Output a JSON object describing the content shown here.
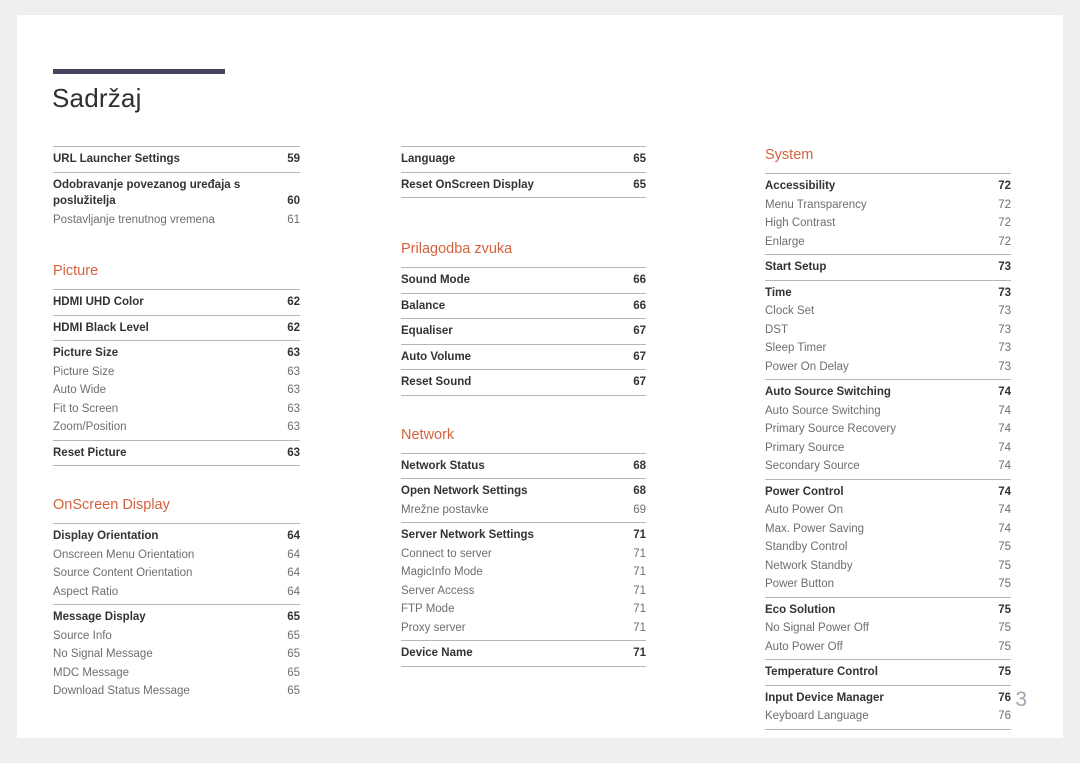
{
  "document": {
    "title": "Sadržaj",
    "folio": "3",
    "accent_color": "#d4623f",
    "rule_color": "#44445c",
    "page_background": "#ffffff",
    "canvas_background": "#efefef"
  },
  "columns": [
    {
      "name": "left",
      "blocks": [
        {
          "type": "group",
          "entries": [
            {
              "label": "URL Launcher Settings",
              "page": "59",
              "level": "main"
            }
          ]
        },
        {
          "type": "group",
          "entries": [
            {
              "label": "Odobravanje povezanog uređaja s poslužitelja",
              "page": "60",
              "level": "main"
            },
            {
              "label": "Postavljanje trenutnog vremena",
              "page": "61",
              "level": "sub"
            }
          ]
        },
        {
          "type": "gap",
          "size": "md"
        },
        {
          "type": "heading",
          "label": "Picture"
        },
        {
          "type": "group",
          "entries": [
            {
              "label": "HDMI UHD Color",
              "page": "62",
              "level": "main"
            }
          ]
        },
        {
          "type": "group",
          "entries": [
            {
              "label": "HDMI Black Level",
              "page": "62",
              "level": "main"
            }
          ]
        },
        {
          "type": "group",
          "entries": [
            {
              "label": "Picture Size",
              "page": "63",
              "level": "main"
            },
            {
              "label": "Picture Size",
              "page": "63",
              "level": "sub"
            },
            {
              "label": "Auto Wide",
              "page": "63",
              "level": "sub"
            },
            {
              "label": "Fit to Screen",
              "page": "63",
              "level": "sub"
            },
            {
              "label": "Zoom/Position",
              "page": "63",
              "level": "sub"
            }
          ]
        },
        {
          "type": "group",
          "last_rule": true,
          "entries": [
            {
              "label": "Reset Picture",
              "page": "63",
              "level": "main"
            }
          ]
        },
        {
          "type": "gap",
          "size": "md"
        },
        {
          "type": "heading",
          "label": "OnScreen Display"
        },
        {
          "type": "group",
          "entries": [
            {
              "label": "Display Orientation",
              "page": "64",
              "level": "main"
            },
            {
              "label": "Onscreen Menu Orientation",
              "page": "64",
              "level": "sub"
            },
            {
              "label": "Source Content Orientation",
              "page": "64",
              "level": "sub"
            },
            {
              "label": "Aspect Ratio",
              "page": "64",
              "level": "sub"
            }
          ]
        },
        {
          "type": "group",
          "entries": [
            {
              "label": "Message Display",
              "page": "65",
              "level": "main"
            },
            {
              "label": "Source Info",
              "page": "65",
              "level": "sub"
            },
            {
              "label": "No Signal Message",
              "page": "65",
              "level": "sub"
            },
            {
              "label": "MDC Message",
              "page": "65",
              "level": "sub"
            },
            {
              "label": "Download Status Message",
              "page": "65",
              "level": "sub"
            }
          ]
        }
      ]
    },
    {
      "name": "middle",
      "blocks": [
        {
          "type": "group",
          "entries": [
            {
              "label": "Language",
              "page": "65",
              "level": "main"
            }
          ]
        },
        {
          "type": "group",
          "last_rule": true,
          "entries": [
            {
              "label": "Reset OnScreen Display",
              "page": "65",
              "level": "main"
            }
          ]
        },
        {
          "type": "gap",
          "size": "lg"
        },
        {
          "type": "heading",
          "label": "Prilagodba zvuka"
        },
        {
          "type": "group",
          "entries": [
            {
              "label": "Sound Mode",
              "page": "66",
              "level": "main"
            }
          ]
        },
        {
          "type": "group",
          "entries": [
            {
              "label": "Balance",
              "page": "66",
              "level": "main"
            }
          ]
        },
        {
          "type": "group",
          "entries": [
            {
              "label": "Equaliser",
              "page": "67",
              "level": "main"
            }
          ]
        },
        {
          "type": "group",
          "entries": [
            {
              "label": "Auto Volume",
              "page": "67",
              "level": "main"
            }
          ]
        },
        {
          "type": "group",
          "last_rule": true,
          "entries": [
            {
              "label": "Reset Sound",
              "page": "67",
              "level": "main"
            }
          ]
        },
        {
          "type": "gap",
          "size": "md"
        },
        {
          "type": "heading",
          "label": "Network"
        },
        {
          "type": "group",
          "entries": [
            {
              "label": "Network Status",
              "page": "68",
              "level": "main"
            }
          ]
        },
        {
          "type": "group",
          "entries": [
            {
              "label": "Open Network Settings",
              "page": "68",
              "level": "main"
            },
            {
              "label": "Mrežne postavke",
              "page": "69",
              "level": "sub"
            }
          ]
        },
        {
          "type": "group",
          "entries": [
            {
              "label": "Server Network Settings",
              "page": "71",
              "level": "main"
            },
            {
              "label": "Connect to server",
              "page": "71",
              "level": "sub"
            },
            {
              "label": "MagicInfo Mode",
              "page": "71",
              "level": "sub"
            },
            {
              "label": "Server Access",
              "page": "71",
              "level": "sub"
            },
            {
              "label": "FTP Mode",
              "page": "71",
              "level": "sub"
            },
            {
              "label": "Proxy server",
              "page": "71",
              "level": "sub"
            }
          ]
        },
        {
          "type": "group",
          "last_rule": true,
          "entries": [
            {
              "label": "Device Name",
              "page": "71",
              "level": "main"
            }
          ]
        }
      ]
    },
    {
      "name": "right",
      "blocks": [
        {
          "type": "heading",
          "label": "System"
        },
        {
          "type": "group",
          "entries": [
            {
              "label": "Accessibility",
              "page": "72",
              "level": "main"
            },
            {
              "label": "Menu Transparency",
              "page": "72",
              "level": "sub"
            },
            {
              "label": "High Contrast",
              "page": "72",
              "level": "sub"
            },
            {
              "label": "Enlarge",
              "page": "72",
              "level": "sub"
            }
          ]
        },
        {
          "type": "group",
          "entries": [
            {
              "label": "Start Setup",
              "page": "73",
              "level": "main"
            }
          ]
        },
        {
          "type": "group",
          "entries": [
            {
              "label": "Time",
              "page": "73",
              "level": "main"
            },
            {
              "label": "Clock Set",
              "page": "73",
              "level": "sub"
            },
            {
              "label": "DST",
              "page": "73",
              "level": "sub"
            },
            {
              "label": "Sleep Timer",
              "page": "73",
              "level": "sub"
            },
            {
              "label": "Power On Delay",
              "page": "73",
              "level": "sub"
            }
          ]
        },
        {
          "type": "group",
          "entries": [
            {
              "label": "Auto Source Switching",
              "page": "74",
              "level": "main"
            },
            {
              "label": "Auto Source Switching",
              "page": "74",
              "level": "sub"
            },
            {
              "label": "Primary Source Recovery",
              "page": "74",
              "level": "sub"
            },
            {
              "label": "Primary Source",
              "page": "74",
              "level": "sub"
            },
            {
              "label": "Secondary Source",
              "page": "74",
              "level": "sub"
            }
          ]
        },
        {
          "type": "group",
          "entries": [
            {
              "label": "Power Control",
              "page": "74",
              "level": "main"
            },
            {
              "label": "Auto Power On",
              "page": "74",
              "level": "sub"
            },
            {
              "label": "Max. Power Saving",
              "page": "74",
              "level": "sub"
            },
            {
              "label": "Standby Control",
              "page": "75",
              "level": "sub"
            },
            {
              "label": "Network Standby",
              "page": "75",
              "level": "sub"
            },
            {
              "label": "Power Button",
              "page": "75",
              "level": "sub"
            }
          ]
        },
        {
          "type": "group",
          "entries": [
            {
              "label": "Eco Solution",
              "page": "75",
              "level": "main"
            },
            {
              "label": "No Signal Power Off",
              "page": "75",
              "level": "sub"
            },
            {
              "label": "Auto Power Off",
              "page": "75",
              "level": "sub"
            }
          ]
        },
        {
          "type": "group",
          "entries": [
            {
              "label": "Temperature Control",
              "page": "75",
              "level": "main"
            }
          ]
        },
        {
          "type": "group",
          "last_rule": true,
          "entries": [
            {
              "label": "Input Device Manager",
              "page": "76",
              "level": "main"
            },
            {
              "label": "Keyboard Language",
              "page": "76",
              "level": "sub"
            }
          ]
        }
      ]
    }
  ]
}
